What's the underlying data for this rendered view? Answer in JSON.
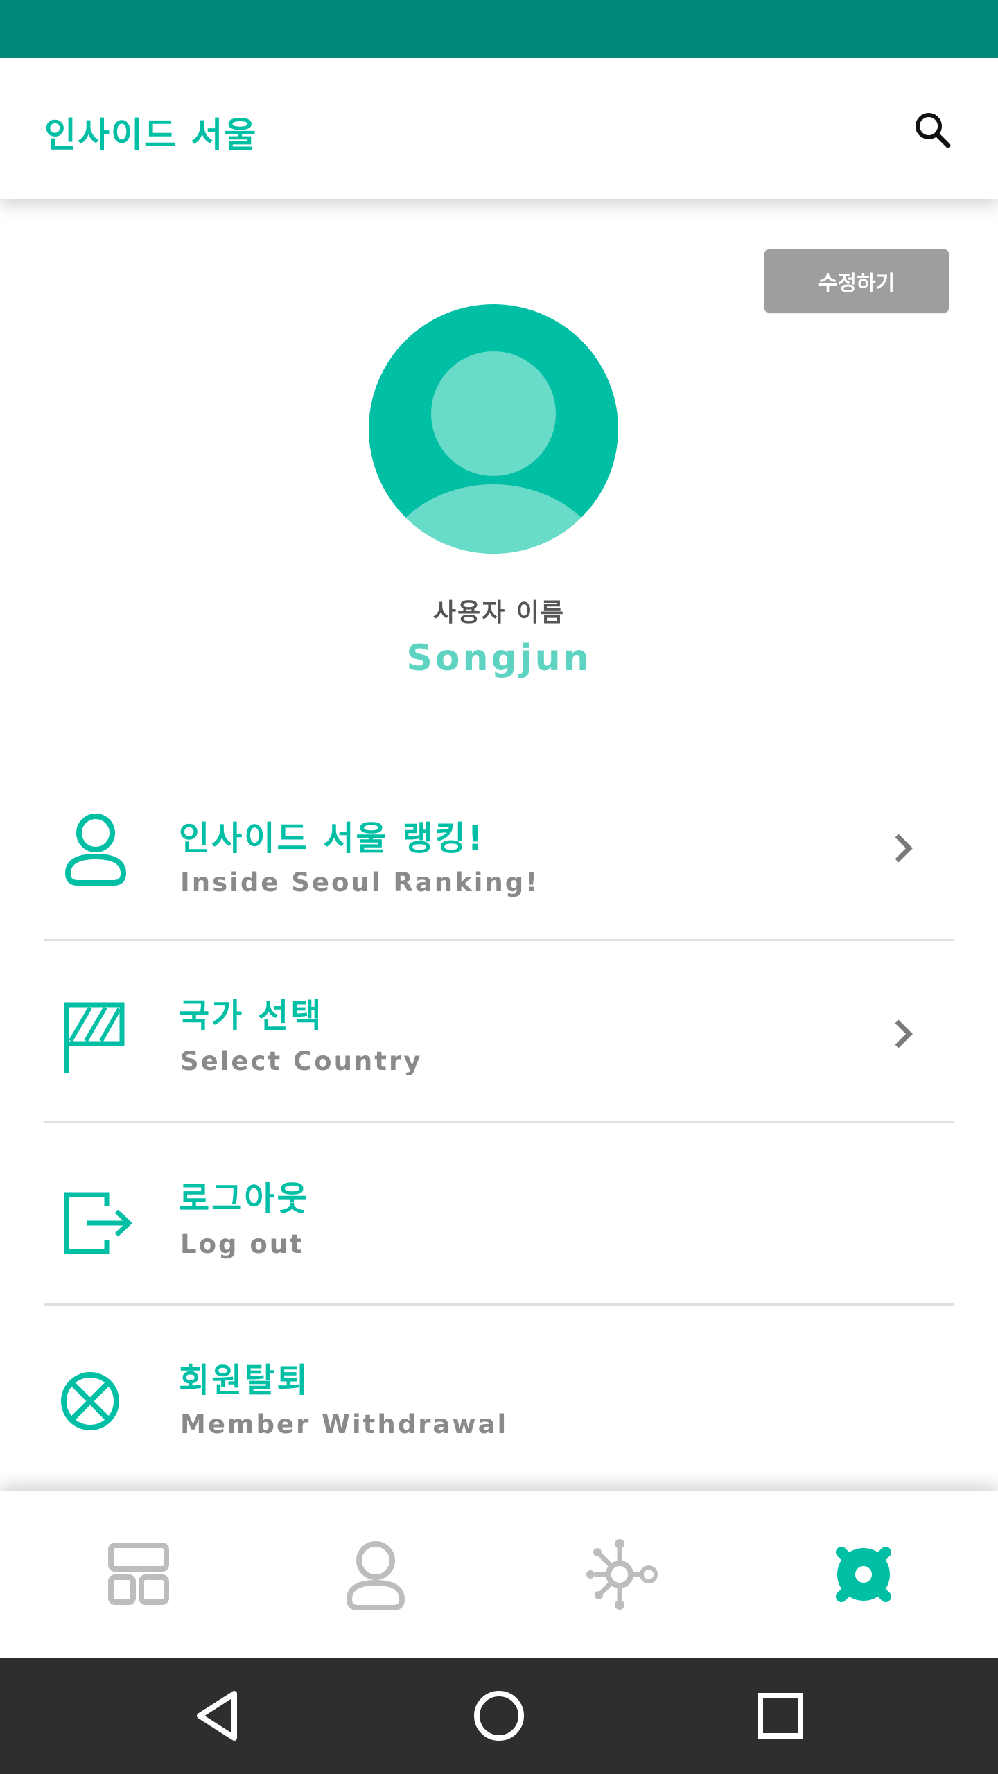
{
  "app_bar": {
    "title": "인사이드 서울",
    "search_icon": "search-icon"
  },
  "profile": {
    "edit_label": "수정하기",
    "name_label": "사용자 이름",
    "name_value": "Songjun",
    "avatar_icon": "user-avatar-icon"
  },
  "menu": {
    "items": [
      {
        "title": "인사이드 서울 랭킹!",
        "subtitle": "Inside Seoul Ranking!",
        "icon": "person-icon",
        "has_chevron": true
      },
      {
        "title": "국가 선택",
        "subtitle": "Select Country",
        "icon": "flag-icon",
        "has_chevron": true
      },
      {
        "title": "로그아웃",
        "subtitle": "Log out",
        "icon": "logout-icon",
        "has_chevron": false
      },
      {
        "title": "회원탈퇴",
        "subtitle": "Member Withdrawal",
        "icon": "withdraw-x-circle-icon",
        "has_chevron": false
      }
    ]
  },
  "bottom_nav": {
    "items": [
      {
        "icon": "dashboard-icon",
        "active": false
      },
      {
        "icon": "profile-icon",
        "active": false
      },
      {
        "icon": "network-icon",
        "active": false
      },
      {
        "icon": "settings-icon",
        "active": true
      }
    ]
  },
  "system_nav": [
    "back-icon",
    "home-icon",
    "recents-icon"
  ],
  "colors": {
    "status_bar": "#00897B",
    "accent": "#00BFA5",
    "name_value": "#5ED3C1",
    "edit_button": "#9E9E9E",
    "subtitle": "#8A8A8A",
    "nav_inactive": "#BDBDBD",
    "system_nav": "#2E2E2E"
  }
}
